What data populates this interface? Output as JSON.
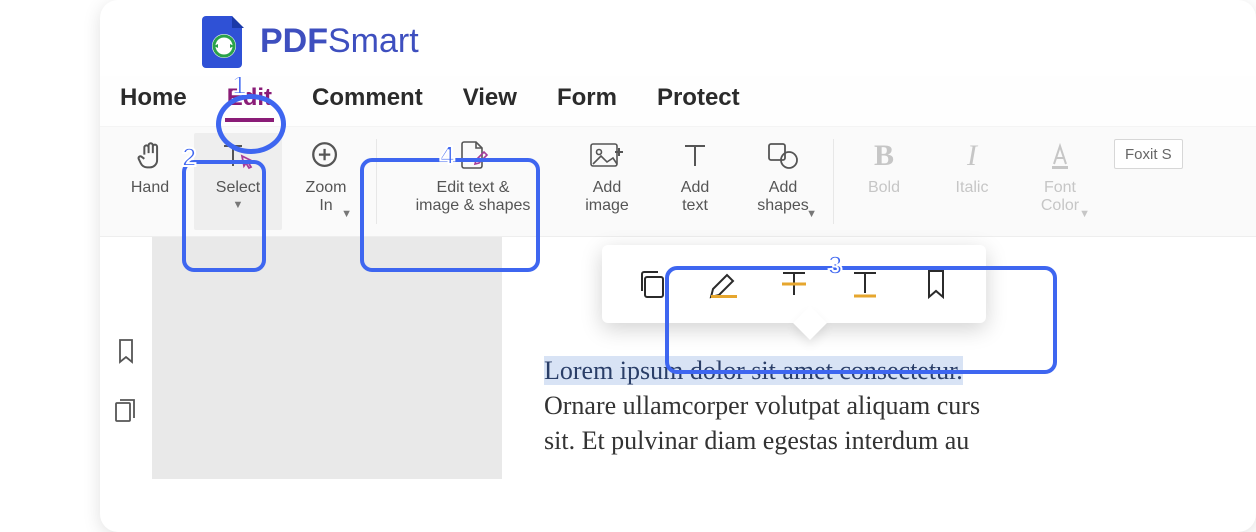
{
  "brand": {
    "bold": "PDF",
    "rest": "Smart"
  },
  "tabs": {
    "items": [
      "Home",
      "Edit",
      "Comment",
      "View",
      "Form",
      "Protect"
    ],
    "active_index": 1
  },
  "ribbon": {
    "hand": "Hand",
    "select": "Select",
    "zoom_in": "Zoom\nIn",
    "edit_combo": "Edit text &\nimage & shapes",
    "add_image": "Add\nimage",
    "add_text": "Add\ntext",
    "add_shapes": "Add\nshapes",
    "bold": "Bold",
    "italic": "Italic",
    "font_color": "Font\nColor",
    "font_name_preview": "Foxit S"
  },
  "context_toolbar": {
    "icons": [
      "copy-icon",
      "highlight-icon",
      "strikethrough-icon",
      "underline-icon",
      "bookmark-icon"
    ]
  },
  "document": {
    "line1": "Lorem ipsum dolor sit amet consectetur.",
    "line2": "Ornare ullamcorper volutpat aliquam curs",
    "line3": "sit. Et pulvinar diam egestas interdum au"
  },
  "annotations": {
    "n1": "1",
    "n2": "2",
    "n3": "3",
    "n4": "4"
  }
}
